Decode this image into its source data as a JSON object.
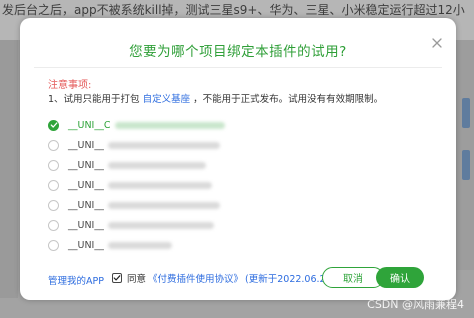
{
  "background": {
    "top_text": "发后台之后，app不被系统kill掉，测试三星s9+、华为、三星、小米稳定运行超过12小",
    "watermark": "CSDN @风雨兼程4"
  },
  "dialog": {
    "title": "您要为哪个项目绑定本插件的试用?",
    "notice": {
      "title": "注意事项:",
      "line_prefix": "1、试用只能用于打包",
      "line_link": "自定义基座",
      "line_suffix": "，不能用于正式发布。试用没有有效期限制。"
    },
    "apps": [
      {
        "prefix": "__UNI__C",
        "selected": true
      },
      {
        "prefix": "__UNI__",
        "selected": false
      },
      {
        "prefix": "__UNI__",
        "selected": false
      },
      {
        "prefix": "__UNI__",
        "selected": false
      },
      {
        "prefix": "__UNI__",
        "selected": false
      },
      {
        "prefix": "__UNI__",
        "selected": false
      },
      {
        "prefix": "__UNI__",
        "selected": false
      }
    ],
    "footer": {
      "manage_label": "管理我的APP",
      "agree_label": "同意",
      "agreement_link": "《付费插件使用协议》",
      "updated_text": "(更新于2022.06.20)",
      "cancel_label": "取消",
      "confirm_label": "确认"
    }
  },
  "colors": {
    "accent": "#2fa43a",
    "link": "#2d6cdf",
    "warning": "#e45a5a"
  }
}
